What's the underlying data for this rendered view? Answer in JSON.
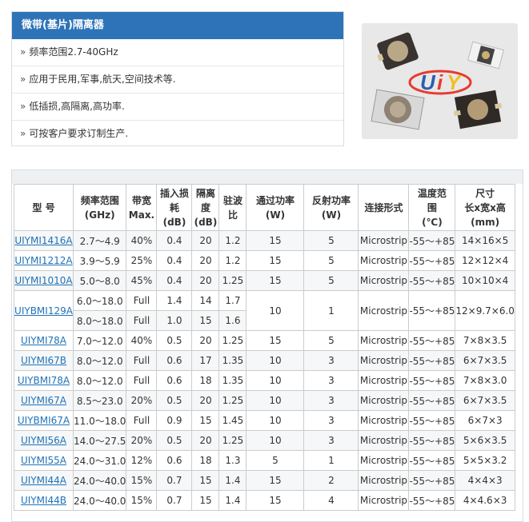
{
  "panel": {
    "title": "微带(基片)隔离器",
    "features": [
      "频率范围2.7-40GHz",
      "应用于民用,军事,航天,空间技术等.",
      "低插损,高隔离,高功率.",
      "可按客户要求订制生产."
    ]
  },
  "brand": {
    "logo_text": "UiY"
  },
  "table": {
    "headers": [
      [
        "型 号"
      ],
      [
        "频率范围",
        "(GHz)"
      ],
      [
        "带宽",
        "Max."
      ],
      [
        "插入损",
        "耗",
        "(dB)"
      ],
      [
        "隔离",
        "度",
        "(dB)"
      ],
      [
        "驻波",
        "比"
      ],
      [
        "通过功率",
        "(W)"
      ],
      [
        "反射功率",
        "(W)"
      ],
      [
        "连接形式"
      ],
      [
        "温度范",
        "围",
        "(℃)"
      ],
      [
        "尺寸",
        "长x宽x高",
        "(mm)"
      ]
    ],
    "rows": [
      {
        "model": "UIYMI1416A",
        "freq": "2.7～4.9",
        "bw": "40%",
        "il": "0.4",
        "iso": "20",
        "vswr": "1.2",
        "fwd": "15",
        "rev": "5",
        "conn": "Microstrip",
        "temp": "-55～+85",
        "size": "14×16×5"
      },
      {
        "model": "UIYMI1212A",
        "freq": "3.9～5.9",
        "bw": "25%",
        "il": "0.4",
        "iso": "20",
        "vswr": "1.2",
        "fwd": "15",
        "rev": "5",
        "conn": "Microstrip",
        "temp": "-55～+85",
        "size": "12×12×4"
      },
      {
        "model": "UIYMI1010A",
        "freq": "5.0～8.0",
        "bw": "45%",
        "il": "0.4",
        "iso": "20",
        "vswr": "1.25",
        "fwd": "15",
        "rev": "5",
        "conn": "Microstrip",
        "temp": "-55～+85",
        "size": "10×10×4"
      },
      {
        "model": "UIYBMI129A",
        "freq": "6.0～18.0",
        "bw": "Full",
        "il": "1.4",
        "iso": "14",
        "vswr": "1.7",
        "fwd": "10",
        "rev": "1",
        "conn": "Microstrip",
        "temp": "-55～+85",
        "size": "12×9.7×6.0",
        "sub": {
          "freq": "8.0～18.0",
          "bw": "Full",
          "il": "1.0",
          "iso": "15",
          "vswr": "1.6"
        }
      },
      {
        "model": "UIYMI78A",
        "freq": "7.0～12.0",
        "bw": "40%",
        "il": "0.5",
        "iso": "20",
        "vswr": "1.25",
        "fwd": "15",
        "rev": "5",
        "conn": "Microstrip",
        "temp": "-55～+85",
        "size": "7×8×3.5"
      },
      {
        "model": "UIYMI67B",
        "freq": "8.0～12.0",
        "bw": "Full",
        "il": "0.6",
        "iso": "17",
        "vswr": "1.35",
        "fwd": "10",
        "rev": "3",
        "conn": "Microstrip",
        "temp": "-55～+85",
        "size": "6×7×3.5"
      },
      {
        "model": "UIYBMI78A",
        "freq": "8.0～12.0",
        "bw": "Full",
        "il": "0.6",
        "iso": "18",
        "vswr": "1.35",
        "fwd": "10",
        "rev": "3",
        "conn": "Microstrip",
        "temp": "-55～+85",
        "size": "7×8×3.0"
      },
      {
        "model": "UIYMI67A",
        "freq": "8.5～23.0",
        "bw": "20%",
        "il": "0.5",
        "iso": "20",
        "vswr": "1.25",
        "fwd": "10",
        "rev": "3",
        "conn": "Microstrip",
        "temp": "-55～+85",
        "size": "6×7×3.5"
      },
      {
        "model": "UIYBMI67A",
        "freq": "11.0～18.0",
        "bw": "Full",
        "il": "0.9",
        "iso": "15",
        "vswr": "1.45",
        "fwd": "10",
        "rev": "3",
        "conn": "Microstrip",
        "temp": "-55～+85",
        "size": "6×7×3"
      },
      {
        "model": "UIYMI56A",
        "freq": "14.0～27.5",
        "bw": "20%",
        "il": "0.5",
        "iso": "20",
        "vswr": "1.25",
        "fwd": "10",
        "rev": "3",
        "conn": "Microstrip",
        "temp": "-55～+85",
        "size": "5×6×3.5"
      },
      {
        "model": "UIYMI55A",
        "freq": "24.0～31.0",
        "bw": "12%",
        "il": "0.6",
        "iso": "18",
        "vswr": "1.3",
        "fwd": "5",
        "rev": "1",
        "conn": "Microstrip",
        "temp": "-55～+85",
        "size": "5×5×3.2"
      },
      {
        "model": "UIYMI44A",
        "freq": "24.0～40.0",
        "bw": "15%",
        "il": "0.7",
        "iso": "15",
        "vswr": "1.4",
        "fwd": "15",
        "rev": "2",
        "conn": "Microstrip",
        "temp": "-55～+85",
        "size": "4×4×3"
      },
      {
        "model": "UIYMI44B",
        "freq": "24.0～40.0",
        "bw": "15%",
        "il": "0.7",
        "iso": "15",
        "vswr": "1.4",
        "fwd": "15",
        "rev": "4",
        "conn": "Microstrip",
        "temp": "-55～+85",
        "size": "4×4.6×3"
      }
    ]
  }
}
